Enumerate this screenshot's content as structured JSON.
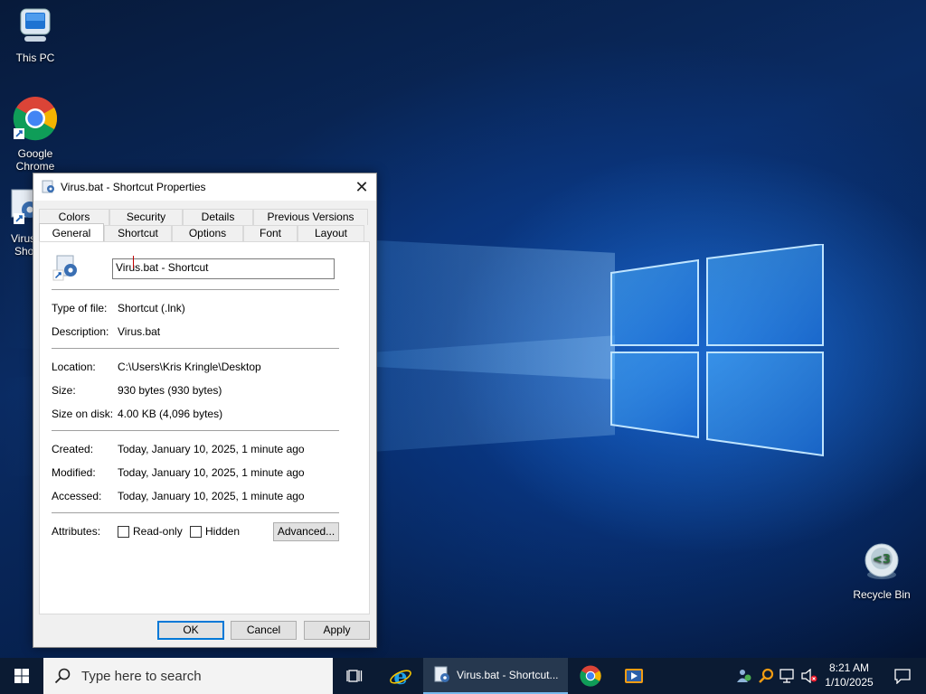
{
  "desktop": {
    "icons": [
      {
        "label": "This PC"
      },
      {
        "label": "Google\nChrome"
      },
      {
        "label": "Virus",
        "label2": "Sho"
      },
      {
        "label": "Recycle Bin"
      }
    ]
  },
  "dialog": {
    "title": "Virus.bat - Shortcut Properties",
    "tabs_top": [
      "Colors",
      "Security",
      "Details",
      "Previous Versions"
    ],
    "tabs_bottom": [
      "General",
      "Shortcut",
      "Options",
      "Font",
      "Layout"
    ],
    "active_tab": "General",
    "name_value": "Virus.bat - Shortcut",
    "fields": {
      "type_label": "Type of file:",
      "type_value": "Shortcut (.lnk)",
      "desc_label": "Description:",
      "desc_value": "Virus.bat",
      "location_label": "Location:",
      "location_value": "C:\\Users\\Kris Kringle\\Desktop",
      "size_label": "Size:",
      "size_value": "930 bytes (930 bytes)",
      "disk_label": "Size on disk:",
      "disk_value": "4.00 KB (4,096 bytes)",
      "created_label": "Created:",
      "created_value": "Today, January 10, 2025, 1 minute ago",
      "modified_label": "Modified:",
      "modified_value": "Today, January 10, 2025, 1 minute ago",
      "accessed_label": "Accessed:",
      "accessed_value": "Today, January 10, 2025, 1 minute ago",
      "attributes_label": "Attributes:",
      "readonly_label": "Read-only",
      "hidden_label": "Hidden",
      "advanced_label": "Advanced..."
    },
    "buttons": {
      "ok": "OK",
      "cancel": "Cancel",
      "apply": "Apply"
    }
  },
  "taskbar": {
    "search_placeholder": "Type here to search",
    "active_window": "Virus.bat - Shortcut...",
    "time": "8:21 AM",
    "date": "1/10/2025"
  },
  "colors": {
    "accent": "#0078d7",
    "taskbar": "#0b1b33"
  }
}
